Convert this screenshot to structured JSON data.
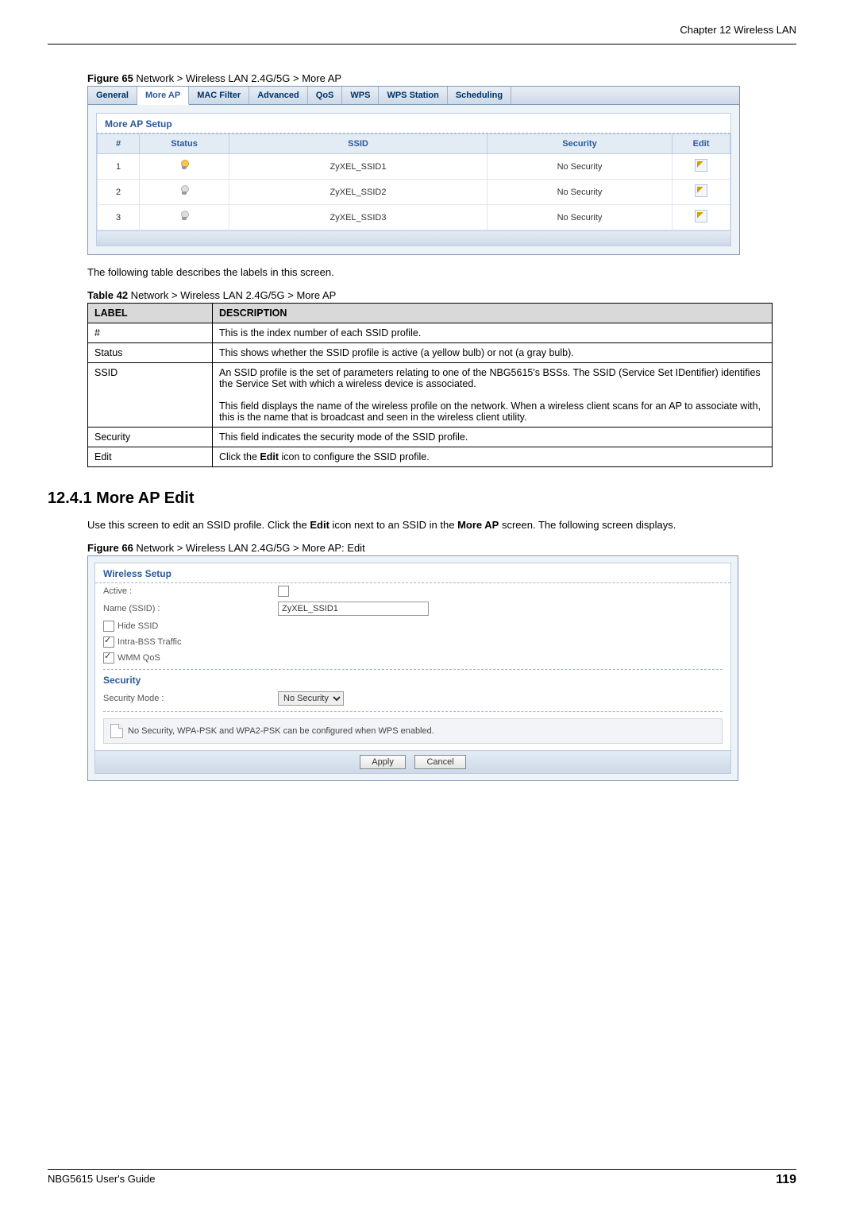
{
  "header": {
    "chapter": "Chapter 12 Wireless LAN"
  },
  "fig65": {
    "label_strong": "Figure 65",
    "label_rest": "   Network > Wireless LAN 2.4G/5G > More AP",
    "tabs": [
      "General",
      "More AP",
      "MAC Filter",
      "Advanced",
      "QoS",
      "WPS",
      "WPS Station",
      "Scheduling"
    ],
    "active_tab_index": 1,
    "section_title": "More AP Setup",
    "columns": [
      "#",
      "Status",
      "SSID",
      "Security",
      "Edit"
    ],
    "rows": [
      {
        "num": "1",
        "status": "on",
        "ssid": "ZyXEL_SSID1",
        "security": "No Security"
      },
      {
        "num": "2",
        "status": "off",
        "ssid": "ZyXEL_SSID2",
        "security": "No Security"
      },
      {
        "num": "3",
        "status": "off",
        "ssid": "ZyXEL_SSID3",
        "security": "No Security"
      }
    ]
  },
  "para1": "The following table describes the labels in this screen.",
  "table42": {
    "label_strong": "Table 42",
    "label_rest": "   Network > Wireless LAN 2.4G/5G > More AP",
    "headers": [
      "LABEL",
      "DESCRIPTION"
    ],
    "rows": [
      {
        "label": "#",
        "desc": "This is the index number of each SSID profile."
      },
      {
        "label": "Status",
        "desc": "This shows whether the SSID profile is active (a yellow bulb) or not (a gray bulb)."
      },
      {
        "label": "SSID",
        "desc": "An SSID profile is the set of parameters relating to one of the NBG5615's BSSs. The SSID (Service Set IDentifier) identifies the Service Set with which a wireless device is associated.\n\nThis field displays the name of the wireless profile on the network. When a wireless client scans for an AP to associate with, this is the name that is broadcast and seen in the wireless client utility."
      },
      {
        "label": "Security",
        "desc": "This field indicates the security mode of the SSID profile."
      },
      {
        "label": "Edit",
        "desc_pre": "Click the ",
        "desc_bold": "Edit",
        "desc_post": " icon to configure the SSID profile."
      }
    ]
  },
  "section1241": {
    "heading": "12.4.1  More AP Edit",
    "para_pre": "Use this screen to edit an SSID profile. Click the ",
    "para_b1": "Edit",
    "para_mid": " icon next to an SSID in the ",
    "para_b2": "More AP",
    "para_post": " screen. The following screen displays."
  },
  "fig66": {
    "label_strong": "Figure 66",
    "label_rest": "   Network > Wireless LAN 2.4G/5G > More AP: Edit",
    "wireless_setup_title": "Wireless Setup",
    "active_label": "Active :",
    "name_label": "Name (SSID) :",
    "name_value": "ZyXEL_SSID1",
    "hide_ssid": "Hide SSID",
    "intra_bss": "Intra-BSS Traffic",
    "wmm": "WMM QoS",
    "security_title": "Security",
    "security_mode_label": "Security Mode :",
    "security_mode_value": "No Security",
    "note": "No Security, WPA-PSK and WPA2-PSK can be configured when WPS enabled.",
    "apply": "Apply",
    "cancel": "Cancel"
  },
  "footer": {
    "guide": "NBG5615 User's Guide",
    "page": "119"
  }
}
